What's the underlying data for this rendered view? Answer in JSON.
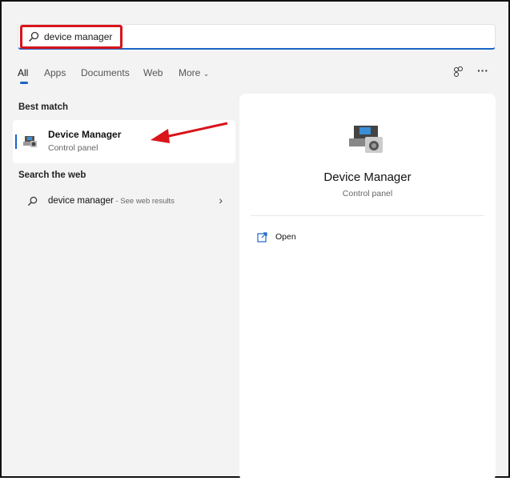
{
  "search": {
    "value": "device manager",
    "icon": "search-icon"
  },
  "tabs": [
    {
      "label": "All",
      "active": true
    },
    {
      "label": "Apps"
    },
    {
      "label": "Documents"
    },
    {
      "label": "Web"
    },
    {
      "label": "More"
    }
  ],
  "header_icons": [
    "share-icon",
    "more-icon"
  ],
  "best_match": {
    "heading": "Best match",
    "title": "Device Manager",
    "subtitle": "Control panel"
  },
  "search_web": {
    "heading": "Search the web",
    "query": "device manager",
    "suffix": " - See web results"
  },
  "detail": {
    "title": "Device Manager",
    "subtitle": "Control panel",
    "actions": [
      {
        "label": "Open",
        "icon": "open-external-icon"
      }
    ]
  },
  "colors": {
    "accent": "#1a66c6",
    "annotation": "#d9141b"
  }
}
